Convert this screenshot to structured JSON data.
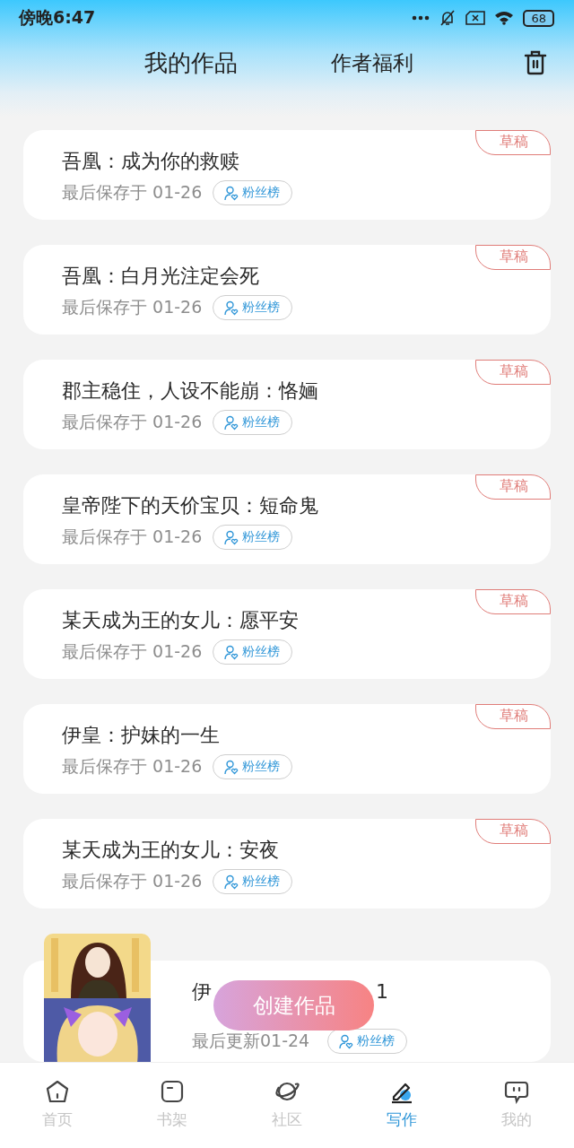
{
  "status_bar": {
    "time": "傍晚6:47",
    "battery": "68"
  },
  "header": {
    "title": "我的作品",
    "benefits_link": "作者福利"
  },
  "works": [
    {
      "kind": "draft",
      "title": "吾凰：成为你的救赎",
      "saved": "最后保存于 01-26",
      "fans": "粉丝榜",
      "tag": "草稿"
    },
    {
      "kind": "draft",
      "title": "吾凰：白月光注定会死",
      "saved": "最后保存于 01-26",
      "fans": "粉丝榜",
      "tag": "草稿"
    },
    {
      "kind": "draft",
      "title": "郡主稳住，人设不能崩：恪婳",
      "saved": "最后保存于 01-26",
      "fans": "粉丝榜",
      "tag": "草稿"
    },
    {
      "kind": "draft",
      "title": "皇帝陛下的天价宝贝：短命鬼",
      "saved": "最后保存于 01-26",
      "fans": "粉丝榜",
      "tag": "草稿"
    },
    {
      "kind": "draft",
      "title": "某天成为王的女儿：愿平安",
      "saved": "最后保存于 01-26",
      "fans": "粉丝榜",
      "tag": "草稿"
    },
    {
      "kind": "draft",
      "title": "伊皇：护妹的一生",
      "saved": "最后保存于 01-26",
      "fans": "粉丝榜",
      "tag": "草稿"
    },
    {
      "kind": "draft",
      "title": "某天成为王的女儿：安夜",
      "saved": "最后保存于 01-26",
      "fans": "粉丝榜",
      "tag": "草稿"
    },
    {
      "kind": "published",
      "title_start": "伊",
      "title_end": "1",
      "saved": "最后更新01-24",
      "fans": "粉丝榜"
    }
  ],
  "create_button": "创建作品",
  "nav": [
    {
      "label": "首页",
      "selected": false
    },
    {
      "label": "书架",
      "selected": false
    },
    {
      "label": "社区",
      "selected": false
    },
    {
      "label": "写作",
      "selected": true
    },
    {
      "label": "我的",
      "selected": false
    }
  ]
}
